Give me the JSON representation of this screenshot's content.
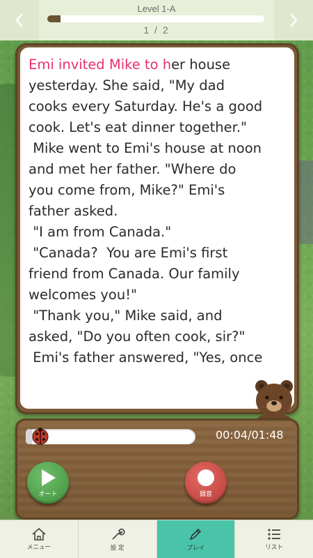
{
  "header": {
    "level_title": "Level 1-A",
    "level_progress": 0.06,
    "page_indicator": "1 / 2",
    "prev_icon": "chevron-left-icon",
    "next_icon": "chevron-right-icon"
  },
  "reading": {
    "highlighted": "Emi invited Mike to h",
    "lines": [
      "er house\nyesterday. She said, \"My dad\ncooks every Saturday. He's a good\ncook. Let's eat dinner together.\"",
      " Mike went to Emi's house at noon\nand met her father. \"Where do\nyou come from, Mike?\" Emi's\nfather asked.",
      " \"I am from Canada.\"",
      " \"Canada?  You are Emi's first\nfriend from Canada. Our family\nwelcomes you!\"",
      " \"Thank you,\" Mike said, and\nasked, \"Do you often cook, sir?\"",
      " Emi's father answered, \"Yes, once"
    ]
  },
  "player": {
    "time": "00:04/01:48",
    "progress": 0.04,
    "auto_label": "オート",
    "record_label": "録音"
  },
  "tabs": [
    {
      "label": "メニュー",
      "icon": "home-icon"
    },
    {
      "label": "設 定",
      "icon": "wrench-icon"
    },
    {
      "label": "プレイ",
      "icon": "pencil-icon",
      "active": true
    },
    {
      "label": "リスト",
      "icon": "list-icon"
    }
  ],
  "colors": {
    "accent": "#49c4a9",
    "highlight_text": "#e9306d",
    "wood": "#7a5a36"
  }
}
